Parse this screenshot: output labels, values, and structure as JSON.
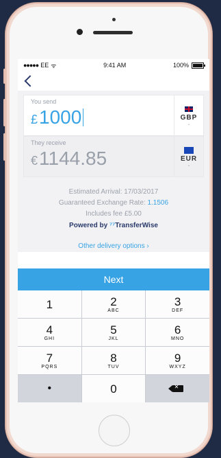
{
  "status": {
    "carrier": "EE",
    "time": "9:41 AM",
    "battery": "100%"
  },
  "send": {
    "label": "You send",
    "symbol": "£",
    "amount": "1000",
    "currency": "GBP"
  },
  "receive": {
    "label": "They receive",
    "symbol": "€",
    "amount": "1144.85",
    "currency": "EUR"
  },
  "info": {
    "arrival": "Estimated Arrival: 17/03/2017",
    "rate_prefix": "Guaranteed Exchange Rate:",
    "rate_value": "1.1506",
    "fee": "Includes fee £5.00",
    "powered_by": "Powered by",
    "brand_mark": "⁷⁷",
    "brand": "TransferWise",
    "other_options": "Other delivery options ›"
  },
  "next_label": "Next",
  "keypad": [
    {
      "num": "1",
      "sub": ""
    },
    {
      "num": "2",
      "sub": "ABC"
    },
    {
      "num": "3",
      "sub": "DEF"
    },
    {
      "num": "4",
      "sub": "GHI"
    },
    {
      "num": "5",
      "sub": "JKL"
    },
    {
      "num": "6",
      "sub": "MNO"
    },
    {
      "num": "7",
      "sub": "PQRS"
    },
    {
      "num": "8",
      "sub": "TUV"
    },
    {
      "num": "9",
      "sub": "WXYZ"
    },
    {
      "num": "•",
      "sub": ""
    },
    {
      "num": "0",
      "sub": ""
    }
  ],
  "colors": {
    "accent": "#37a3e5",
    "brand_navy": "#2a3a6b"
  }
}
